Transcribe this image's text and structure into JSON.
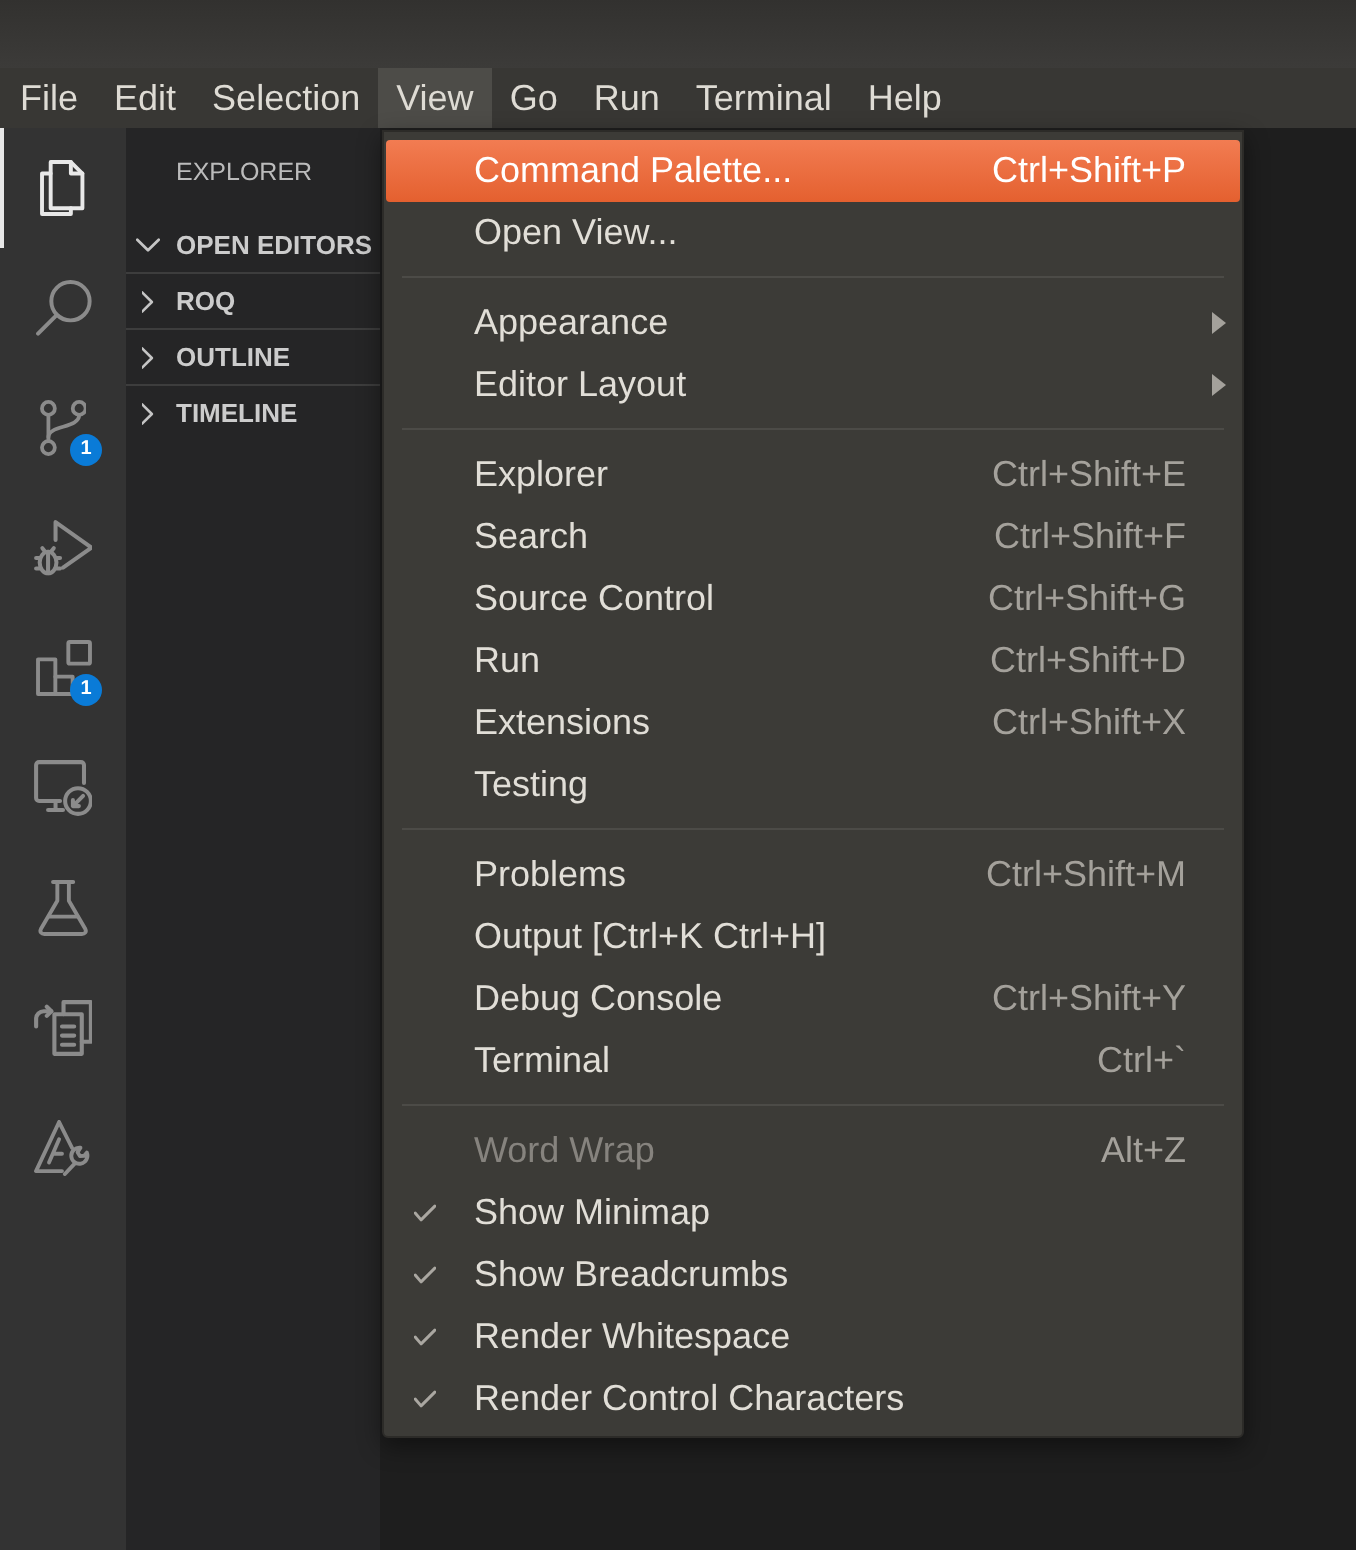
{
  "menubar": [
    {
      "label": "File",
      "selected": false
    },
    {
      "label": "Edit",
      "selected": false
    },
    {
      "label": "Selection",
      "selected": false
    },
    {
      "label": "View",
      "selected": true
    },
    {
      "label": "Go",
      "selected": false
    },
    {
      "label": "Run",
      "selected": false
    },
    {
      "label": "Terminal",
      "selected": false
    },
    {
      "label": "Help",
      "selected": false
    }
  ],
  "activity_bar": [
    {
      "selected": true
    },
    {
      "selected": false
    },
    {
      "selected": false,
      "badge": "1"
    },
    {
      "selected": false
    },
    {
      "selected": false,
      "badge": "1"
    },
    {
      "selected": false
    },
    {
      "selected": false
    },
    {
      "selected": false
    },
    {
      "selected": false
    }
  ],
  "sidebar": {
    "title": "EXPLORER",
    "sections": [
      {
        "label": "OPEN EDITORS",
        "expanded": true
      },
      {
        "label": "ROQ",
        "expanded": false
      },
      {
        "label": "OUTLINE",
        "expanded": false
      },
      {
        "label": "TIMELINE",
        "expanded": false
      }
    ]
  },
  "view_menu": {
    "groups": [
      {
        "items": [
          {
            "label": "Command Palette...",
            "shortcut": "Ctrl+Shift+P",
            "selected": true,
            "checked": false,
            "disabled": false,
            "submenu": false
          },
          {
            "label": "Open View...",
            "selected": false,
            "checked": false,
            "disabled": false,
            "submenu": false
          }
        ]
      },
      {
        "items": [
          {
            "label": "Appearance",
            "selected": false,
            "checked": false,
            "disabled": false,
            "submenu": true
          },
          {
            "label": "Editor Layout",
            "selected": false,
            "checked": false,
            "disabled": false,
            "submenu": true
          }
        ]
      },
      {
        "items": [
          {
            "label": "Explorer",
            "shortcut": "Ctrl+Shift+E",
            "selected": false,
            "checked": false,
            "disabled": false,
            "submenu": false
          },
          {
            "label": "Search",
            "shortcut": "Ctrl+Shift+F",
            "selected": false,
            "checked": false,
            "disabled": false,
            "submenu": false
          },
          {
            "label": "Source Control",
            "shortcut": "Ctrl+Shift+G",
            "selected": false,
            "checked": false,
            "disabled": false,
            "submenu": false
          },
          {
            "label": "Run",
            "shortcut": "Ctrl+Shift+D",
            "selected": false,
            "checked": false,
            "disabled": false,
            "submenu": false
          },
          {
            "label": "Extensions",
            "shortcut": "Ctrl+Shift+X",
            "selected": false,
            "checked": false,
            "disabled": false,
            "submenu": false
          },
          {
            "label": "Testing",
            "selected": false,
            "checked": false,
            "disabled": false,
            "submenu": false
          }
        ]
      },
      {
        "items": [
          {
            "label": "Problems",
            "shortcut": "Ctrl+Shift+M",
            "selected": false,
            "checked": false,
            "disabled": false,
            "submenu": false
          },
          {
            "label": "Output [Ctrl+K Ctrl+H]",
            "selected": false,
            "checked": false,
            "disabled": false,
            "submenu": false
          },
          {
            "label": "Debug Console",
            "shortcut": "Ctrl+Shift+Y",
            "selected": false,
            "checked": false,
            "disabled": false,
            "submenu": false
          },
          {
            "label": "Terminal",
            "shortcut": "Ctrl+`",
            "selected": false,
            "checked": false,
            "disabled": false,
            "submenu": false
          }
        ]
      },
      {
        "items": [
          {
            "label": "Word Wrap",
            "shortcut": "Alt+Z",
            "selected": false,
            "checked": false,
            "disabled": true,
            "submenu": false
          },
          {
            "label": "Show Minimap",
            "selected": false,
            "checked": true,
            "disabled": false,
            "submenu": false
          },
          {
            "label": "Show Breadcrumbs",
            "selected": false,
            "checked": true,
            "disabled": false,
            "submenu": false
          },
          {
            "label": "Render Whitespace",
            "selected": false,
            "checked": true,
            "disabled": false,
            "submenu": false
          },
          {
            "label": "Render Control Characters",
            "selected": false,
            "checked": true,
            "disabled": false,
            "submenu": false
          }
        ]
      }
    ]
  }
}
